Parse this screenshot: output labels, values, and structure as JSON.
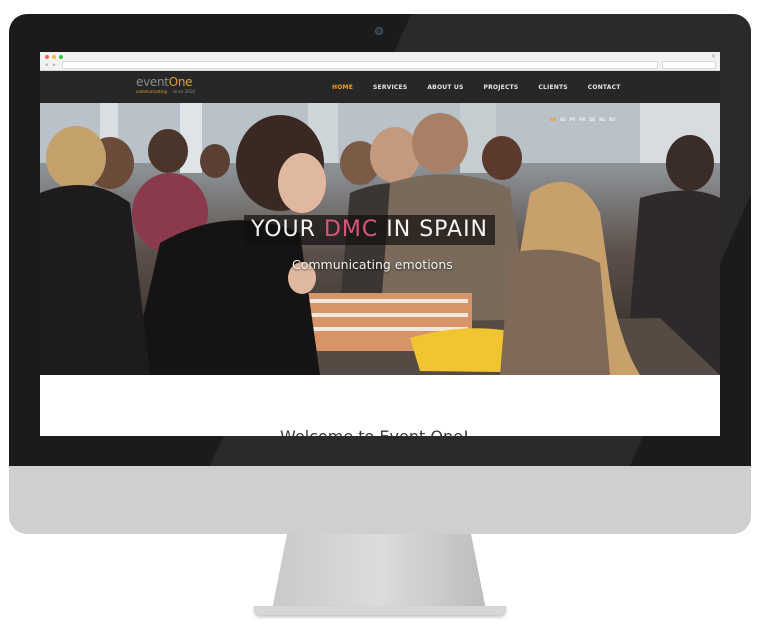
{
  "browser": {
    "traffic_lights": [
      "#f26559",
      "#f5be3b",
      "#35c74a"
    ],
    "back_forward": "◂ ▸",
    "close": "×"
  },
  "site": {
    "logo": {
      "text_main": "event",
      "text_accent": "One",
      "tagline": "communicating",
      "since": "since 2016"
    },
    "nav": {
      "items": [
        "HOME",
        "SERVICES",
        "ABOUT US",
        "PROJECTS",
        "CLIENTS",
        "CONTACT"
      ],
      "active": "HOME"
    },
    "languages": [
      "EN",
      "ES",
      "PT",
      "FR",
      "DE",
      "NL",
      "RU"
    ],
    "active_language": "EN",
    "hero": {
      "title_pre": "YOUR",
      "title_highlight": "DMC",
      "title_post": "IN SPAIN",
      "subtitle": "Communicating emotions"
    },
    "welcome": "Welcome to Event One!"
  },
  "colors": {
    "accent": "#f0a01e",
    "highlight": "#d9567f",
    "header_bg": "#272727",
    "frame": "#1b1b1b"
  }
}
